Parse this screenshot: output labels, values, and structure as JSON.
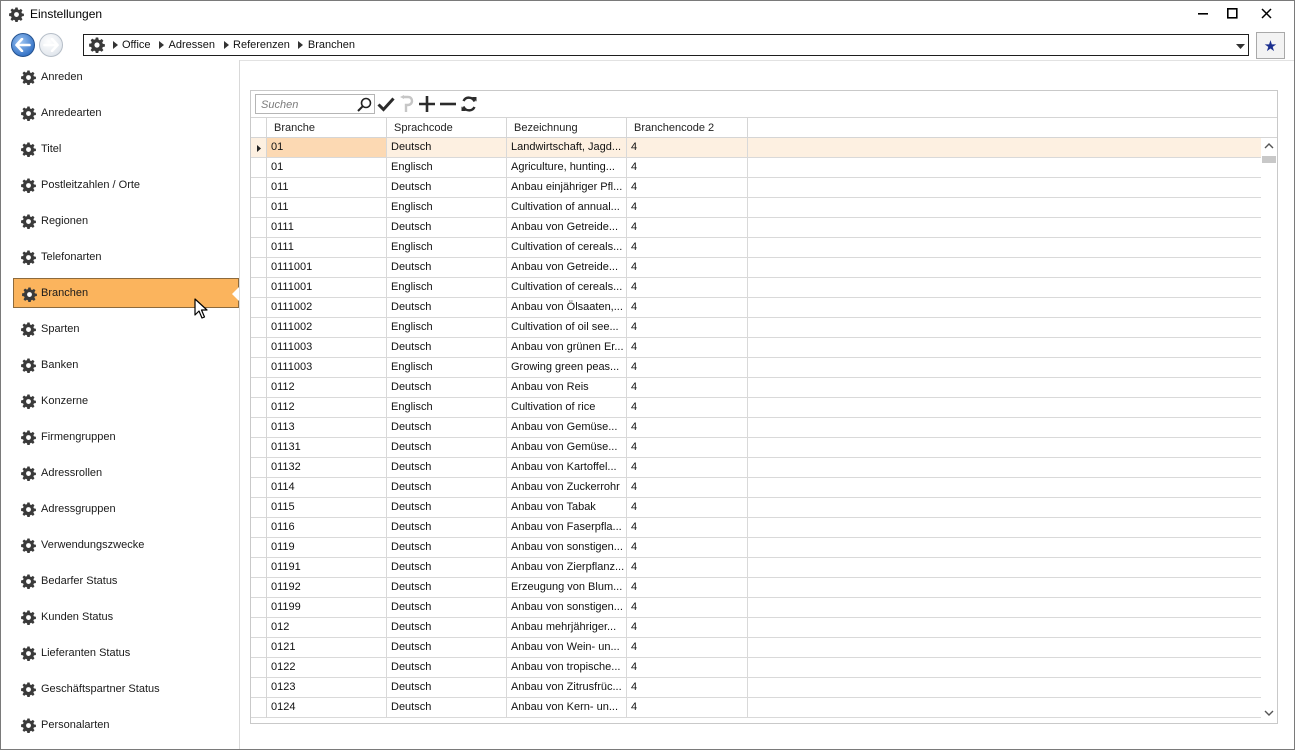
{
  "window": {
    "title": "Einstellungen",
    "minimize": "—",
    "maximize": "☐",
    "close": "✕"
  },
  "address": {
    "crumbs": [
      "Office",
      "Adressen",
      "Referenzen",
      "Branchen"
    ]
  },
  "sidebar": {
    "items": [
      {
        "label": "Anreden"
      },
      {
        "label": "Anredearten"
      },
      {
        "label": "Titel"
      },
      {
        "label": "Postleitzahlen / Orte"
      },
      {
        "label": "Regionen"
      },
      {
        "label": "Telefonarten"
      },
      {
        "label": "Branchen",
        "selected": true
      },
      {
        "label": "Sparten"
      },
      {
        "label": "Banken"
      },
      {
        "label": "Konzerne"
      },
      {
        "label": "Firmengruppen"
      },
      {
        "label": "Adressrollen"
      },
      {
        "label": "Adressgruppen"
      },
      {
        "label": "Verwendungszwecke"
      },
      {
        "label": "Bedarfer Status"
      },
      {
        "label": "Kunden Status"
      },
      {
        "label": "Lieferanten Status"
      },
      {
        "label": "Geschäftspartner Status"
      },
      {
        "label": "Personalarten"
      }
    ]
  },
  "toolbar": {
    "search_placeholder": "Suchen"
  },
  "table": {
    "columns": [
      "Branche",
      "Sprachcode",
      "Bezeichnung",
      "Branchencode 2"
    ],
    "rows": [
      [
        "01",
        "Deutsch",
        "Landwirtschaft, Jagd...",
        "4"
      ],
      [
        "01",
        "Englisch",
        "Agriculture, hunting...",
        "4"
      ],
      [
        "011",
        "Deutsch",
        "Anbau einjähriger Pfl...",
        "4"
      ],
      [
        "011",
        "Englisch",
        "Cultivation of annual...",
        "4"
      ],
      [
        "0111",
        "Deutsch",
        "Anbau von Getreide...",
        "4"
      ],
      [
        "0111",
        "Englisch",
        "Cultivation of cereals...",
        "4"
      ],
      [
        "0111001",
        "Deutsch",
        "Anbau von Getreide...",
        "4"
      ],
      [
        "0111001",
        "Englisch",
        "Cultivation of cereals...",
        "4"
      ],
      [
        "0111002",
        "Deutsch",
        "Anbau von Ölsaaten,...",
        "4"
      ],
      [
        "0111002",
        "Englisch",
        "Cultivation of oil see...",
        "4"
      ],
      [
        "0111003",
        "Deutsch",
        "Anbau von grünen Er...",
        "4"
      ],
      [
        "0111003",
        "Englisch",
        "Growing green peas...",
        "4"
      ],
      [
        "0112",
        "Deutsch",
        "Anbau von Reis",
        "4"
      ],
      [
        "0112",
        "Englisch",
        "Cultivation of rice",
        "4"
      ],
      [
        "0113",
        "Deutsch",
        "Anbau von Gemüse...",
        "4"
      ],
      [
        "01131",
        "Deutsch",
        "Anbau von Gemüse...",
        "4"
      ],
      [
        "01132",
        "Deutsch",
        "Anbau von Kartoffel...",
        "4"
      ],
      [
        "0114",
        "Deutsch",
        "Anbau von Zuckerrohr",
        "4"
      ],
      [
        "0115",
        "Deutsch",
        "Anbau von Tabak",
        "4"
      ],
      [
        "0116",
        "Deutsch",
        "Anbau von Faserpfla...",
        "4"
      ],
      [
        "0119",
        "Deutsch",
        "Anbau von sonstigen...",
        "4"
      ],
      [
        "01191",
        "Deutsch",
        "Anbau von Zierpflanz...",
        "4"
      ],
      [
        "01192",
        "Deutsch",
        "Erzeugung von Blum...",
        "4"
      ],
      [
        "01199",
        "Deutsch",
        "Anbau von sonstigen...",
        "4"
      ],
      [
        "012",
        "Deutsch",
        "Anbau mehrjähriger...",
        "4"
      ],
      [
        "0121",
        "Deutsch",
        "Anbau von Wein- un...",
        "4"
      ],
      [
        "0122",
        "Deutsch",
        "Anbau von tropische...",
        "4"
      ],
      [
        "0123",
        "Deutsch",
        "Anbau von Zitrusfrüc...",
        "4"
      ],
      [
        "0124",
        "Deutsch",
        "Anbau von Kern- un...",
        "4"
      ]
    ]
  },
  "colors": {
    "selected_item_bg": "#fbb45d",
    "current_row_bg": "#fdf0e1",
    "current_cell_bg": "#fcd9b3",
    "favorite_star": "#1b2f8f",
    "back_button": "#3b78c9"
  }
}
